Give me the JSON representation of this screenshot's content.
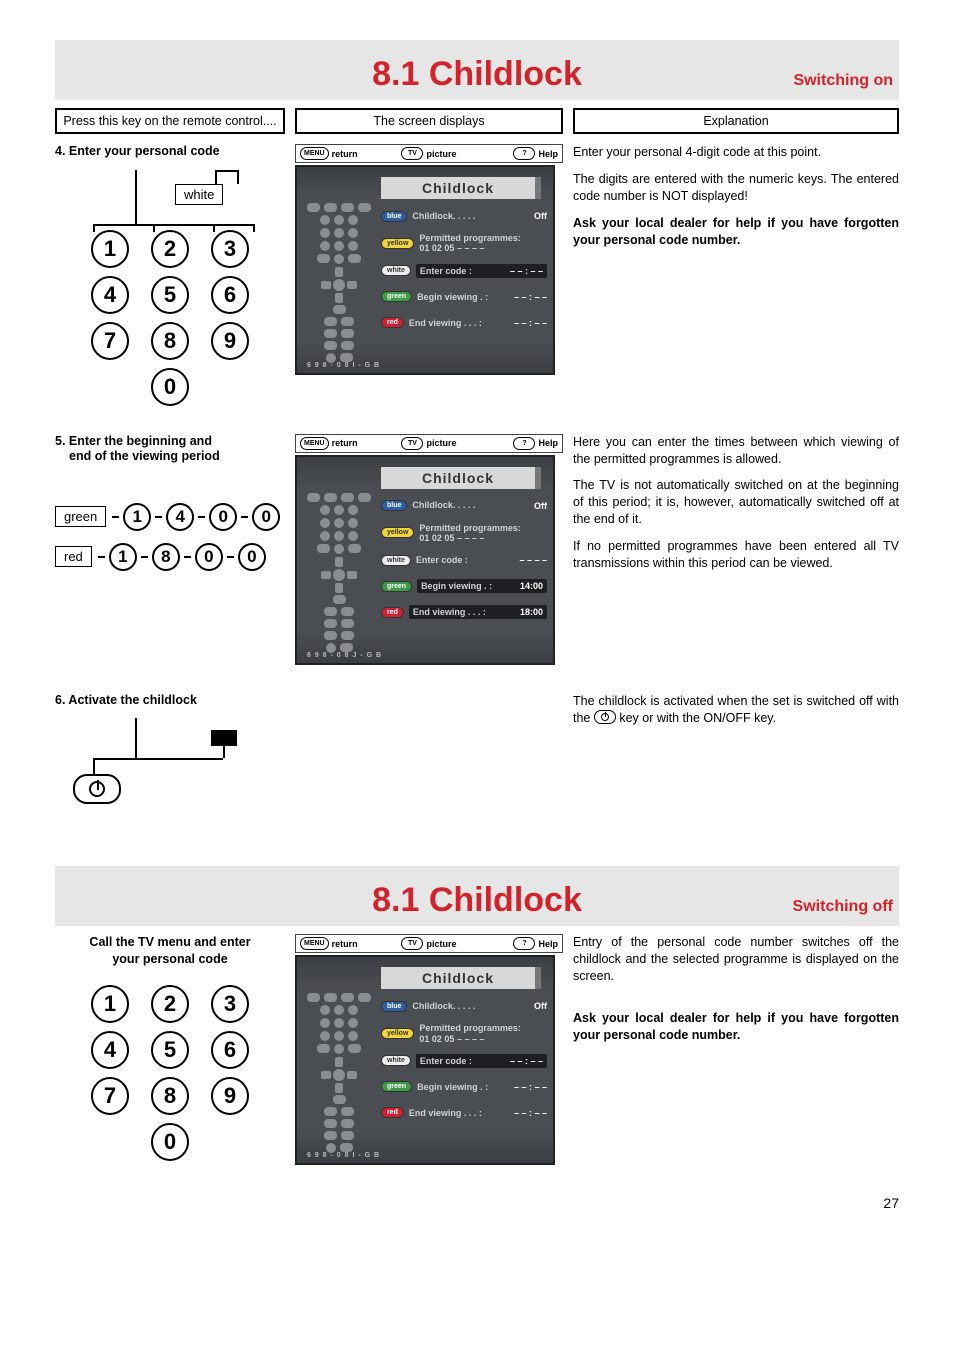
{
  "page_number": "27",
  "section_on": {
    "title": "8.1 Childlock",
    "subtitle": "Switching on",
    "header": {
      "col1": "Press this key on the remote control....",
      "col2": "The screen displays",
      "col3": "Explanation"
    },
    "step4": {
      "label": "4. Enter your personal code",
      "pointer_label": "white",
      "osd": {
        "topbar": {
          "return": "return",
          "picture": "picture",
          "help": "Help",
          "menu_key": "MENU",
          "tv_key": "TV",
          "help_key": "?"
        },
        "title": "Childlock",
        "blue": {
          "key": "blue",
          "label": "Childlock. . . . .",
          "value": "Off"
        },
        "yellow": {
          "key": "yellow",
          "label": "Permitted programmes:",
          "sub": "01  02  05  – –  – –"
        },
        "white": {
          "key": "white",
          "label": "Enter code  :",
          "value": "– – : – –"
        },
        "green": {
          "key": "green",
          "label": "Begin viewing . :",
          "value": "– – : – –"
        },
        "red": {
          "key": "red",
          "label": "End viewing . . . :",
          "value": "– – : – –"
        },
        "code": "6 9 8 - 0 8 I - G B"
      },
      "explain": {
        "p1": "Enter your personal 4-digit code at this point.",
        "p2": "The digits are entered with the numeric keys. The entered code number is NOT displayed!",
        "p3": "Ask your local dealer for help if you have forgotten your personal code number."
      }
    },
    "step5": {
      "label_l1": "5. Enter the beginning and",
      "label_l2": "end of the viewing period",
      "green_label": "green",
      "green_seq": [
        "1",
        "4",
        "0",
        "0"
      ],
      "red_label": "red",
      "red_seq": [
        "1",
        "8",
        "0",
        "0"
      ],
      "osd": {
        "topbar": {
          "return": "return",
          "picture": "picture",
          "help": "Help",
          "menu_key": "MENU",
          "tv_key": "TV",
          "help_key": "?"
        },
        "title": "Childlock",
        "blue": {
          "key": "blue",
          "label": "Childlock. . . . .",
          "value": "Off"
        },
        "yellow": {
          "key": "yellow",
          "label": "Permitted programmes:",
          "sub": "01  02  05  – –  – –"
        },
        "white": {
          "key": "white",
          "label": "Enter code  :",
          "value": "– – – –"
        },
        "green": {
          "key": "green",
          "label": "Begin viewing . :",
          "value": "14:00"
        },
        "red": {
          "key": "red",
          "label": "End viewing . . . :",
          "value": "18:00"
        },
        "code": "6 9 8 - 0 8 J - G B"
      },
      "explain": {
        "p1": "Here you can enter the times between which viewing of the permitted programmes is allowed.",
        "p2": "The TV is not automatically switched on at the beginning of this period; it is, however, automatically switched off at the end of it.",
        "p3": "If no permitted programmes have been entered all TV transmissions within this period can be viewed."
      }
    },
    "step6": {
      "label": "6. Activate the childlock",
      "explain": {
        "p1_a": "The childlock is activated when the set is switched off with the ",
        "p1_b": " key or with the ON/OFF key."
      }
    }
  },
  "section_off": {
    "title": "8.1 Childlock",
    "subtitle": "Switching off",
    "left_l1": "Call the TV menu and enter",
    "left_l2": "your personal code",
    "osd": {
      "topbar": {
        "return": "return",
        "picture": "picture",
        "help": "Help",
        "menu_key": "MENU",
        "tv_key": "TV",
        "help_key": "?"
      },
      "title": "Childlock",
      "blue": {
        "key": "blue",
        "label": "Childlock. . . . .",
        "value": "Off"
      },
      "yellow": {
        "key": "yellow",
        "label": "Permitted programmes:",
        "sub": "01  02  05  – –  – –"
      },
      "white": {
        "key": "white",
        "label": "Enter code  :",
        "value": "– – : – –"
      },
      "green": {
        "key": "green",
        "label": "Begin viewing . :",
        "value": "– – : – –"
      },
      "red": {
        "key": "red",
        "label": "End viewing . . . :",
        "value": "– – : – –"
      },
      "code": "6 9 8 - 0 8 I - G B"
    },
    "explain": {
      "p1": "Entry of the personal code number switches off the childlock and the selected programme is displayed on the screen.",
      "p2": "Ask your local dealer for help if you have forgotten your personal code number."
    }
  },
  "keypad": [
    "1",
    "2",
    "3",
    "4",
    "5",
    "6",
    "7",
    "8",
    "9",
    "0"
  ]
}
